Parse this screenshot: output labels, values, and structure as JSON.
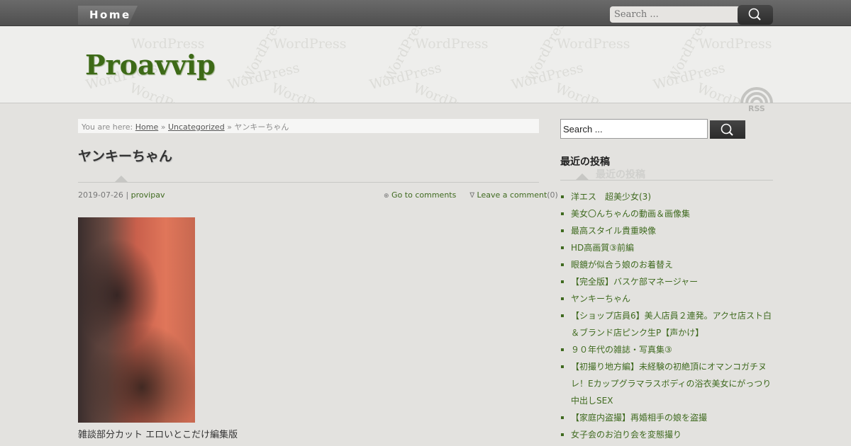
{
  "nav": {
    "home_label": "Home"
  },
  "top_search": {
    "placeholder": "Search ..."
  },
  "header": {
    "site_title": "Proavvip",
    "watermark_text": "WordPress",
    "rss_label": "RSS"
  },
  "breadcrumb": {
    "prefix": "You are here:",
    "home": "Home",
    "sep1": "»",
    "category": "Uncategorized",
    "sep2": "»",
    "current": "ヤンキーちゃん"
  },
  "post": {
    "title": "ヤンキーちゃん",
    "date": "2019-07-26",
    "meta_sep": "|",
    "author": "provipav",
    "comments_link": "Go to comments",
    "leave_comment": "Leave a comment",
    "comment_count": "(0)",
    "caption": "雑談部分カット エロいとこだけ編集版"
  },
  "sidebar": {
    "search_value": "Search ...",
    "widget_title": "最近の投稿",
    "recent_posts": [
      "洋エス　超美少女(3)",
      "美女〇んちゃんの動画＆画像集",
      "最高スタイル貴重映像",
      "HD高画質③前編",
      "眼鏡が似合う娘のお着替え",
      "【完全版】バスケ部マネージャー",
      "ヤンキーちゃん",
      "【ショップ店員6】美人店員２連発。アクセ店スト白＆ブランド店ピンク生P【声かけ】",
      "９０年代の雑誌・写真集③",
      "【初撮り地方編】未経験の初絶頂にオマンコガチヌレ！Eカップグラマラスボディの浴衣美女にがっつり中出しSEX",
      "【家庭内盗撮】再婚相手の娘を盗撮",
      "女子会のお泊り会を変態撮り"
    ]
  },
  "icons": {
    "search": "search-icon",
    "rss": "rss-icon",
    "comment": "comment-icon",
    "reply": "reply-icon"
  },
  "colors": {
    "link_green": "#3f6a1f",
    "title_green": "#3d6a17",
    "topbar": "#5a5a5a"
  }
}
